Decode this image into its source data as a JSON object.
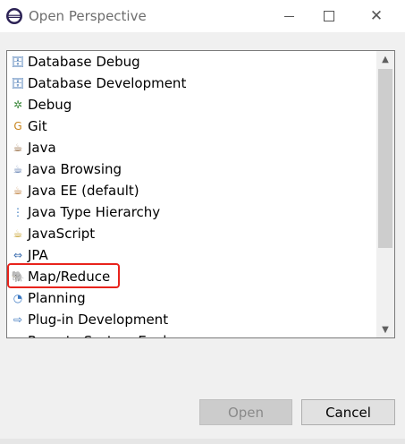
{
  "window": {
    "title": "Open Perspective",
    "minimize_glyph": "",
    "close_glyph": "✕"
  },
  "perspectives": [
    {
      "label": "Database Debug",
      "icon": "database-debug-icon",
      "glyph": "🗄"
    },
    {
      "label": "Database Development",
      "icon": "database-development-icon",
      "glyph": "🗄"
    },
    {
      "label": "Debug",
      "icon": "bug-icon",
      "glyph": "✲"
    },
    {
      "label": "Git",
      "icon": "git-icon",
      "glyph": "G"
    },
    {
      "label": "Java",
      "icon": "java-icon",
      "glyph": "☕"
    },
    {
      "label": "Java Browsing",
      "icon": "java-browsing-icon",
      "glyph": "☕"
    },
    {
      "label": "Java EE (default)",
      "icon": "java-ee-icon",
      "glyph": "☕"
    },
    {
      "label": "Java Type Hierarchy",
      "icon": "type-hierarchy-icon",
      "glyph": "⋮"
    },
    {
      "label": "JavaScript",
      "icon": "javascript-icon",
      "glyph": "☕"
    },
    {
      "label": "JPA",
      "icon": "jpa-icon",
      "glyph": "⇔"
    },
    {
      "label": "Map/Reduce",
      "icon": "elephant-icon",
      "glyph": "🐘"
    },
    {
      "label": "Planning",
      "icon": "planning-icon",
      "glyph": "◔"
    },
    {
      "label": "Plug-in Development",
      "icon": "plugin-icon",
      "glyph": "⇨"
    },
    {
      "label": "Remote System Explorer",
      "icon": "remote-system-icon",
      "glyph": "▤"
    }
  ],
  "highlighted_item": "Map/Reduce",
  "buttons": {
    "open": "Open",
    "cancel": "Cancel"
  },
  "colors": {
    "highlight_border": "#e8231c",
    "open_disabled_bg": "#cccccc",
    "cancel_bg": "#e1e1e1"
  }
}
